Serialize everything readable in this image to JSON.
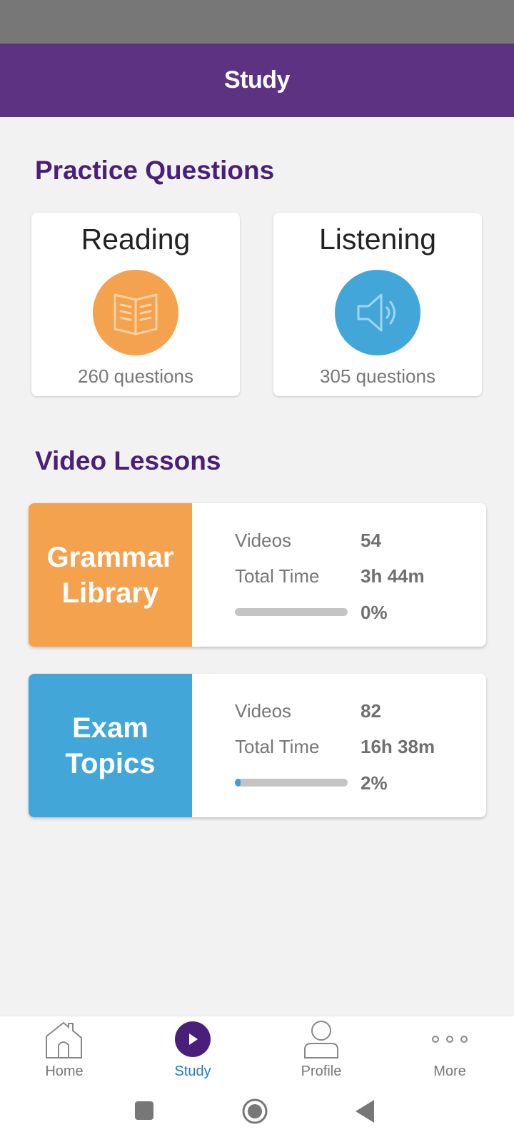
{
  "header": {
    "title": "Study"
  },
  "practice": {
    "title": "Practice Questions",
    "cards": [
      {
        "name": "Reading",
        "count": "260 questions",
        "icon": "open-book-icon",
        "color": "#f4a24e"
      },
      {
        "name": "Listening",
        "count": "305 questions",
        "icon": "speaker-icon",
        "color": "#42a6d9"
      }
    ]
  },
  "videos": {
    "title": "Video Lessons",
    "lessons": [
      {
        "line1": "Grammar",
        "line2": "Library",
        "color": "#f4a24e",
        "videos_label": "Videos",
        "videos": "54",
        "time_label": "Total Time",
        "time": "3h 44m",
        "progress_pct": 0,
        "progress_label": "0%"
      },
      {
        "line1": "Exam",
        "line2": "Topics",
        "color": "#42a6d9",
        "videos_label": "Videos",
        "videos": "82",
        "time_label": "Total Time",
        "time": "16h 38m",
        "progress_pct": 2,
        "progress_label": "2%"
      }
    ]
  },
  "nav": {
    "items": [
      {
        "label": "Home",
        "icon": "home-icon"
      },
      {
        "label": "Study",
        "icon": "play-circle-icon",
        "active": true
      },
      {
        "label": "Profile",
        "icon": "person-icon"
      },
      {
        "label": "More",
        "icon": "more-dots-icon"
      }
    ]
  },
  "colors": {
    "primary": "#5e3282",
    "heading": "#4a1f7a",
    "active_nav": "#1f7ad1"
  }
}
